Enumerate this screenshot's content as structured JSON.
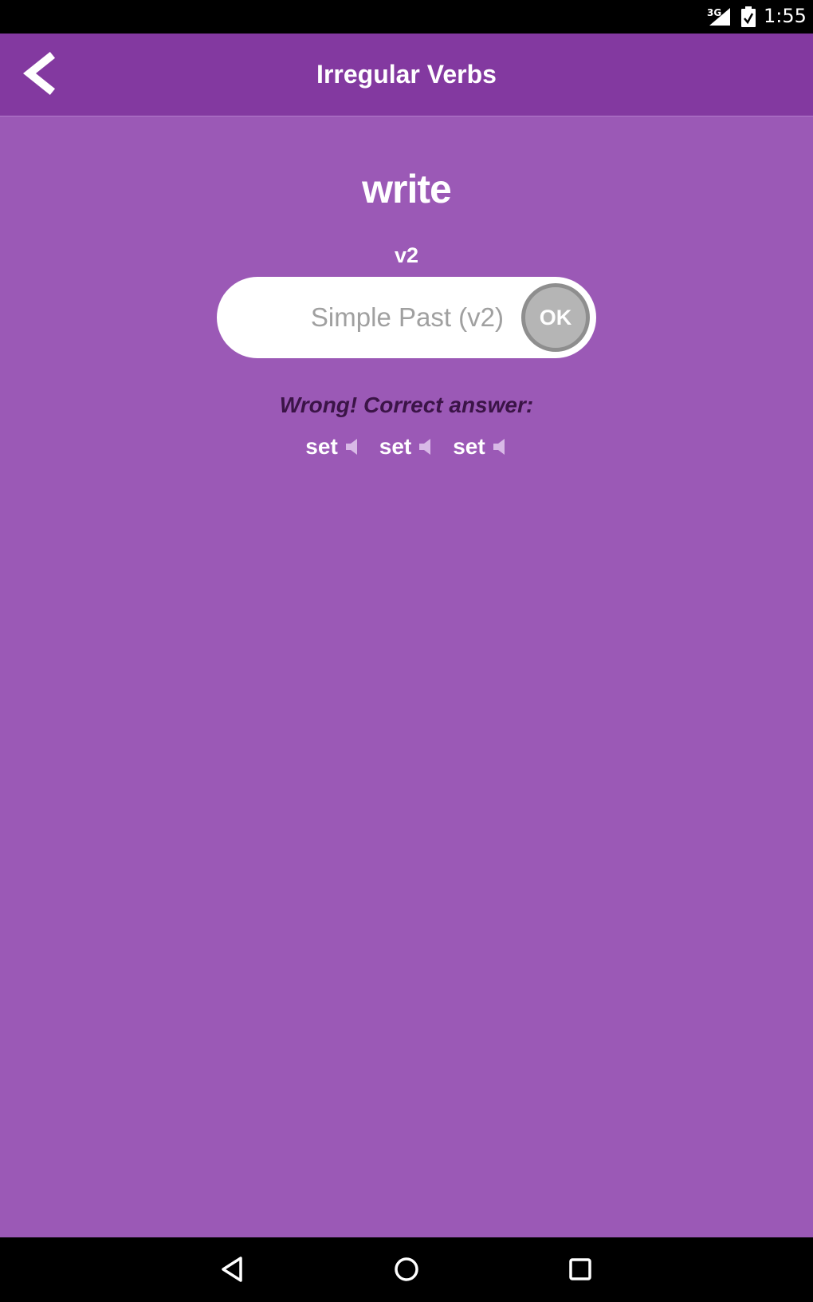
{
  "status_bar": {
    "network": "3G",
    "time": "1:55"
  },
  "app_bar": {
    "title": "Irregular Verbs",
    "back_icon": "chevron-left-icon"
  },
  "quiz": {
    "verb": "write",
    "form_label": "v2",
    "input_placeholder": "Simple Past (v2)",
    "input_value": "",
    "ok_label": "OK",
    "feedback": "Wrong! Correct answer:",
    "answers": [
      {
        "word": "set",
        "icon": "speaker-icon"
      },
      {
        "word": "set",
        "icon": "speaker-icon"
      },
      {
        "word": "set",
        "icon": "speaker-icon"
      }
    ]
  },
  "colors": {
    "background": "#9b59b6",
    "app_bar": "#8339a0",
    "feedback_text": "#3b1447",
    "ok_button": "#b5b5b5"
  },
  "nav_bar": {
    "back_icon": "triangle-back-icon",
    "home_icon": "circle-home-icon",
    "recents_icon": "square-recents-icon"
  }
}
